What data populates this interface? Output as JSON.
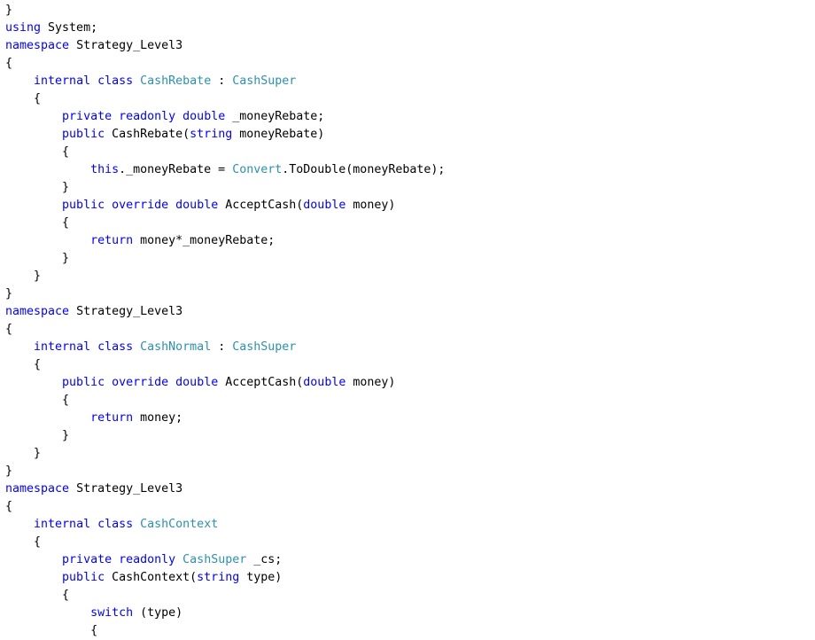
{
  "colors": {
    "background": "#ffffff",
    "keyword": "#0000ff",
    "type": "#2b91af",
    "plain": "#000000"
  },
  "code_lines": [
    [
      [
        "p",
        "}"
      ]
    ],
    [
      [
        "k",
        "using"
      ],
      [
        "p",
        " System;"
      ]
    ],
    [
      [
        "k",
        "namespace"
      ],
      [
        "p",
        " Strategy_Level3"
      ]
    ],
    [
      [
        "p",
        "{"
      ]
    ],
    [
      [
        "p",
        "    "
      ],
      [
        "k",
        "internal"
      ],
      [
        "p",
        " "
      ],
      [
        "k",
        "class"
      ],
      [
        "p",
        " "
      ],
      [
        "t",
        "CashRebate"
      ],
      [
        "p",
        " : "
      ],
      [
        "t",
        "CashSuper"
      ]
    ],
    [
      [
        "p",
        "    {"
      ]
    ],
    [
      [
        "p",
        "        "
      ],
      [
        "k",
        "private"
      ],
      [
        "p",
        " "
      ],
      [
        "k",
        "readonly"
      ],
      [
        "p",
        " "
      ],
      [
        "k",
        "double"
      ],
      [
        "p",
        " _moneyRebate;"
      ]
    ],
    [
      [
        "p",
        "        "
      ],
      [
        "k",
        "public"
      ],
      [
        "p",
        " CashRebate("
      ],
      [
        "k",
        "string"
      ],
      [
        "p",
        " moneyRebate)"
      ]
    ],
    [
      [
        "p",
        "        {"
      ]
    ],
    [
      [
        "p",
        "            "
      ],
      [
        "k",
        "this"
      ],
      [
        "p",
        "._moneyRebate = "
      ],
      [
        "t",
        "Convert"
      ],
      [
        "p",
        ".ToDouble(moneyRebate);"
      ]
    ],
    [
      [
        "p",
        "        }"
      ]
    ],
    [
      [
        "p",
        "        "
      ],
      [
        "k",
        "public"
      ],
      [
        "p",
        " "
      ],
      [
        "k",
        "override"
      ],
      [
        "p",
        " "
      ],
      [
        "k",
        "double"
      ],
      [
        "p",
        " AcceptCash("
      ],
      [
        "k",
        "double"
      ],
      [
        "p",
        " money)"
      ]
    ],
    [
      [
        "p",
        "        {"
      ]
    ],
    [
      [
        "p",
        "            "
      ],
      [
        "k",
        "return"
      ],
      [
        "p",
        " money*_moneyRebate;"
      ]
    ],
    [
      [
        "p",
        "        }"
      ]
    ],
    [
      [
        "p",
        "    }"
      ]
    ],
    [
      [
        "p",
        "}"
      ]
    ],
    [
      [
        "k",
        "namespace"
      ],
      [
        "p",
        " Strategy_Level3"
      ]
    ],
    [
      [
        "p",
        "{"
      ]
    ],
    [
      [
        "p",
        "    "
      ],
      [
        "k",
        "internal"
      ],
      [
        "p",
        " "
      ],
      [
        "k",
        "class"
      ],
      [
        "p",
        " "
      ],
      [
        "t",
        "CashNormal"
      ],
      [
        "p",
        " : "
      ],
      [
        "t",
        "CashSuper"
      ]
    ],
    [
      [
        "p",
        "    {"
      ]
    ],
    [
      [
        "p",
        "        "
      ],
      [
        "k",
        "public"
      ],
      [
        "p",
        " "
      ],
      [
        "k",
        "override"
      ],
      [
        "p",
        " "
      ],
      [
        "k",
        "double"
      ],
      [
        "p",
        " AcceptCash("
      ],
      [
        "k",
        "double"
      ],
      [
        "p",
        " money)"
      ]
    ],
    [
      [
        "p",
        "        {"
      ]
    ],
    [
      [
        "p",
        "            "
      ],
      [
        "k",
        "return"
      ],
      [
        "p",
        " money;"
      ]
    ],
    [
      [
        "p",
        "        }"
      ]
    ],
    [
      [
        "p",
        "    }"
      ]
    ],
    [
      [
        "p",
        "}"
      ]
    ],
    [
      [
        "k",
        "namespace"
      ],
      [
        "p",
        " Strategy_Level3"
      ]
    ],
    [
      [
        "p",
        "{"
      ]
    ],
    [
      [
        "p",
        "    "
      ],
      [
        "k",
        "internal"
      ],
      [
        "p",
        " "
      ],
      [
        "k",
        "class"
      ],
      [
        "p",
        " "
      ],
      [
        "t",
        "CashContext"
      ]
    ],
    [
      [
        "p",
        "    {"
      ]
    ],
    [
      [
        "p",
        "        "
      ],
      [
        "k",
        "private"
      ],
      [
        "p",
        " "
      ],
      [
        "k",
        "readonly"
      ],
      [
        "p",
        " "
      ],
      [
        "t",
        "CashSuper"
      ],
      [
        "p",
        " _cs;"
      ]
    ],
    [
      [
        "p",
        "        "
      ],
      [
        "k",
        "public"
      ],
      [
        "p",
        " CashContext("
      ],
      [
        "k",
        "string"
      ],
      [
        "p",
        " type)"
      ]
    ],
    [
      [
        "p",
        "        {"
      ]
    ],
    [
      [
        "p",
        "            "
      ],
      [
        "k",
        "switch"
      ],
      [
        "p",
        " (type)"
      ]
    ],
    [
      [
        "p",
        "            {"
      ]
    ]
  ]
}
